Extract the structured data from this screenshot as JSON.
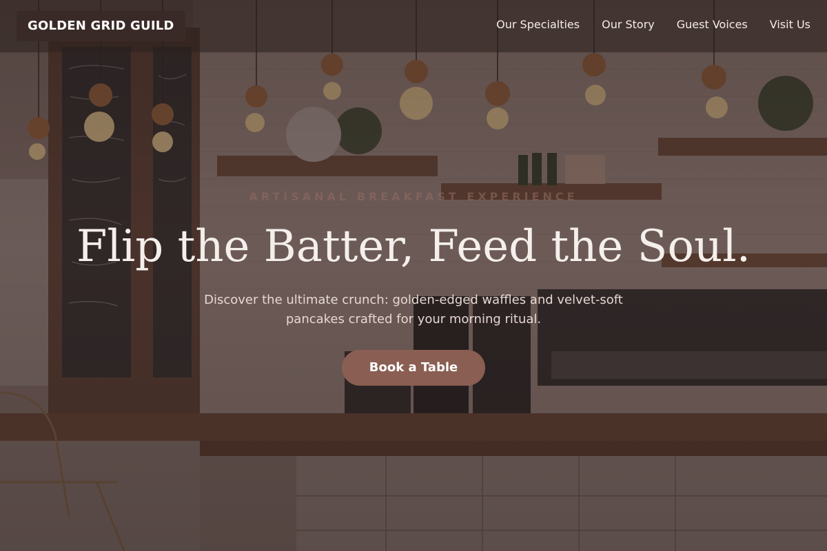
{
  "brand": {
    "name": "GOLDEN GRID GUILD"
  },
  "nav": {
    "items": [
      {
        "label": "Our Specialties"
      },
      {
        "label": "Our Story"
      },
      {
        "label": "Guest Voices"
      },
      {
        "label": "Visit Us"
      }
    ]
  },
  "hero": {
    "eyebrow": "ARTISANAL BREAKFAST EXPERIENCE",
    "title": "Flip the Batter, Feed the Soul.",
    "subtitle": "Discover the ultimate crunch: golden-edged waffles and velvet-soft pancakes crafted for your morning ritual.",
    "cta_label": "Book a Table"
  },
  "theme": {
    "accent": "#8a5e52",
    "logo_bg": "#3a2a27",
    "overlay": "#2c201e"
  }
}
